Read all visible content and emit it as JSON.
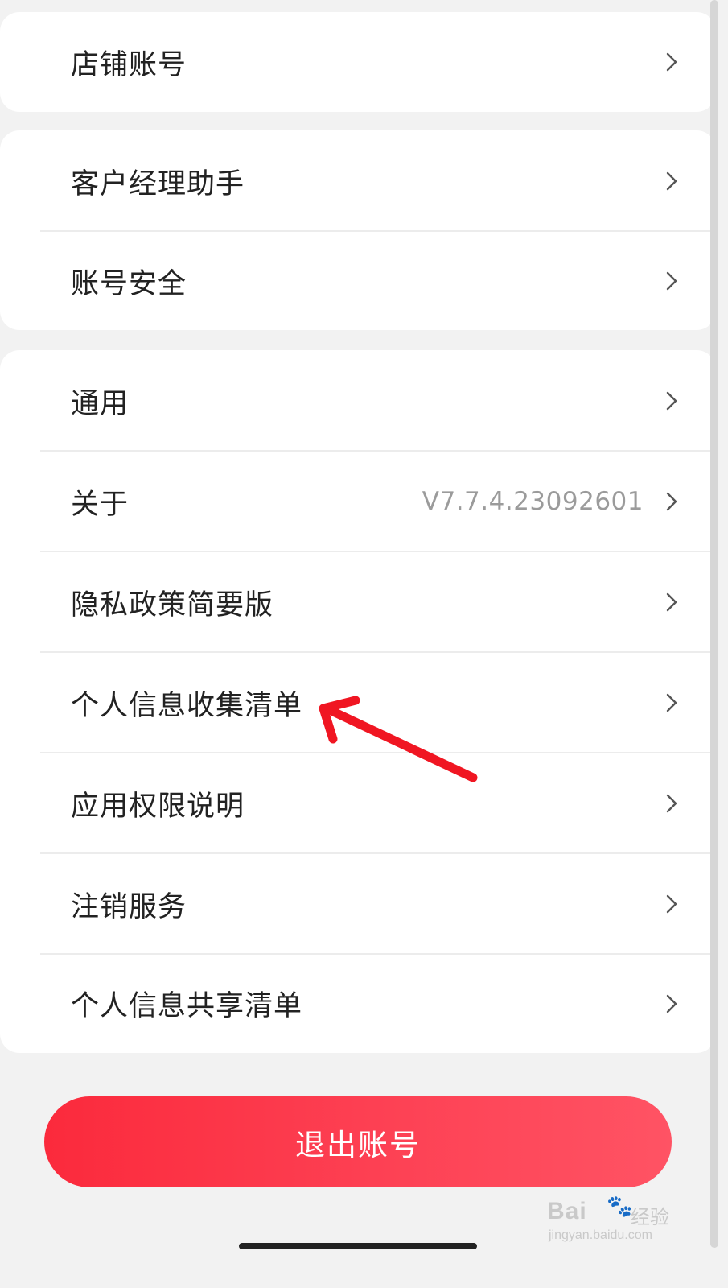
{
  "settings": {
    "group1": [
      {
        "label": "店铺账号"
      }
    ],
    "group2": [
      {
        "label": "客户经理助手"
      },
      {
        "label": "账号安全"
      }
    ],
    "group3": [
      {
        "label": "通用"
      },
      {
        "label": "关于",
        "value": "V7.7.4.23092601"
      },
      {
        "label": "隐私政策简要版"
      },
      {
        "label": "个人信息收集清单"
      },
      {
        "label": "应用权限说明"
      },
      {
        "label": "注销服务"
      },
      {
        "label": "个人信息共享清单"
      }
    ]
  },
  "logout": {
    "label": "退出账号"
  },
  "watermark": {
    "brand": "Bai",
    "brand_cn": "经验",
    "url": "jingyan.baidu.com"
  },
  "icons": {
    "row_arrow": "chevron-right-icon",
    "annotation": "red-arrow-annotation"
  },
  "colors": {
    "accent": "#fb2a3c",
    "annotation": "#f01622",
    "background": "#f2f2f2"
  }
}
